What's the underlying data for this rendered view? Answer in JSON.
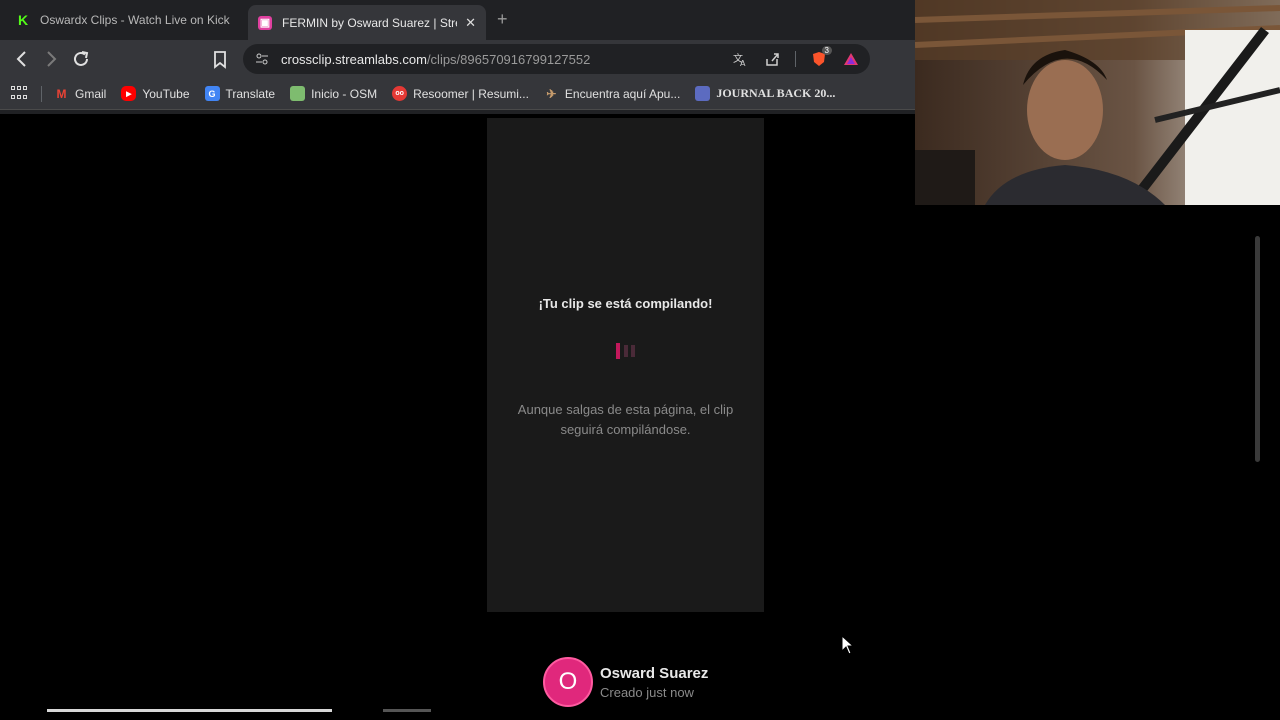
{
  "tabs": [
    {
      "title": "Oswardx Clips - Watch Live on Kick",
      "favicon": "kick-icon",
      "active": false
    },
    {
      "title": "FERMIN by Osward Suarez | Stre",
      "favicon": "streamlabs-icon",
      "active": true,
      "close": "✕"
    }
  ],
  "newtab_label": "+",
  "toolbar": {
    "url_host": "crossclip.streamlabs.com",
    "url_path": "/clips/896570916799127552",
    "brave_badge": "3"
  },
  "bookmarks": [
    {
      "label": "Gmail",
      "icon": "gmail-icon",
      "color": "#ea4335",
      "glyph": "M"
    },
    {
      "label": "YouTube",
      "icon": "youtube-icon",
      "color": "#ff0000",
      "glyph": "▶"
    },
    {
      "label": "Translate",
      "icon": "translate-icon",
      "color": "#4285f4",
      "glyph": "G"
    },
    {
      "label": "Inicio - OSM",
      "icon": "osm-icon",
      "color": "#7ebc6f",
      "glyph": ""
    },
    {
      "label": "Resoomer | Resumi...",
      "icon": "resoomer-icon",
      "color": "#e53935",
      "glyph": "oo"
    },
    {
      "label": "Encuentra aquí Apu...",
      "icon": "apuntes-icon",
      "color": "#c49a6c",
      "glyph": ""
    },
    {
      "label": "JOURNAL BACK 20...",
      "icon": "journal-icon",
      "color": "#5c6bc0",
      "glyph": ""
    }
  ],
  "clip": {
    "title": "¡Tu clip se está compilando!",
    "note": "Aunque salgas de esta página, el clip seguirá compilándose."
  },
  "author": {
    "initial": "O",
    "name": "Osward Suarez",
    "created": "Creado just now"
  },
  "colors": {
    "accent": "#e0287c",
    "loader_active": "#c2185b",
    "loader_dim": "#4a2a38"
  }
}
